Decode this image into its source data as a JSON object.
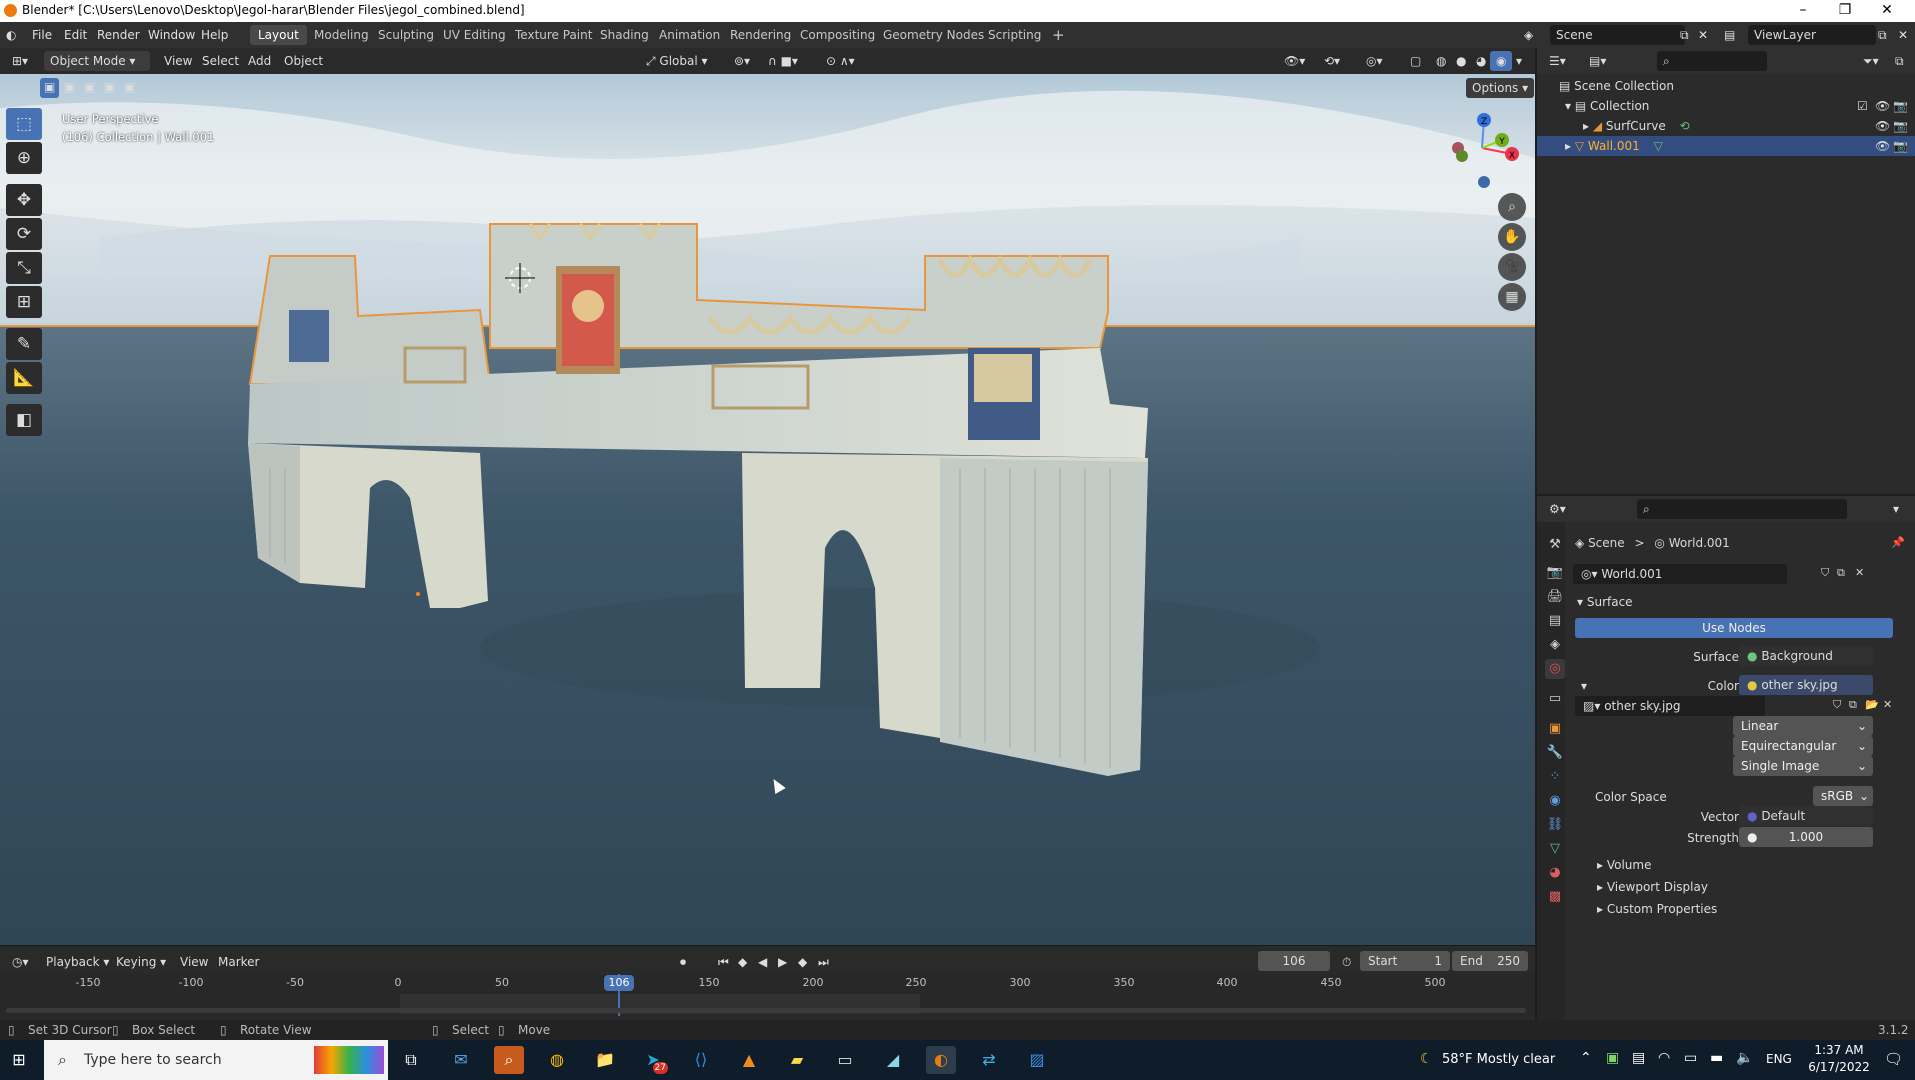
{
  "window": {
    "title": "Blender* [C:\\Users\\Lenovo\\Desktop\\Jegol-harar\\Blender Files\\jegol_combined.blend]"
  },
  "menus": [
    "File",
    "Edit",
    "Render",
    "Window",
    "Help"
  ],
  "workspaces": [
    "Layout",
    "Modeling",
    "Sculpting",
    "UV Editing",
    "Texture Paint",
    "Shading",
    "Animation",
    "Rendering",
    "Compositing",
    "Geometry Nodes",
    "Scripting"
  ],
  "add_workspace": "+",
  "scene": {
    "label": "Scene",
    "viewlayer": "ViewLayer"
  },
  "viewport": {
    "mode": "Object Mode",
    "menus": [
      "View",
      "Select",
      "Add",
      "Object"
    ],
    "transform": "Global",
    "options": "Options",
    "overlay_line1": "User Perspective",
    "overlay_line2": "(106) Collection | Wall.001",
    "gizmo": {
      "z": "Z",
      "y": "Y",
      "x": "X"
    }
  },
  "outliner": {
    "root": "Scene Collection",
    "items": [
      {
        "label": "Collection"
      },
      {
        "label": "SurfCurve"
      },
      {
        "label": "Wall.001"
      }
    ]
  },
  "properties": {
    "breadcrumb_scene": "Scene",
    "breadcrumb_sep": ">",
    "breadcrumb_world": "World.001",
    "world_name": "World.001",
    "surface_panel": "Surface",
    "use_nodes": "Use Nodes",
    "surface_label": "Surface",
    "surface_value": "Background",
    "color_label": "Color",
    "color_value": "other sky.jpg",
    "image_name": "other sky.jpg",
    "interpolation": "Linear",
    "projection": "Equirectangular",
    "source": "Single Image",
    "colorspace_label": "Color Space",
    "colorspace_value": "sRGB",
    "vector_label": "Vector",
    "vector_value": "Default",
    "strength_label": "Strength",
    "strength_value": "1.000",
    "panels": [
      "Volume",
      "Viewport Display",
      "Custom Properties"
    ]
  },
  "timeline": {
    "menus": [
      "Playback",
      "Keying",
      "View",
      "Marker"
    ],
    "current_frame": "106",
    "start_label": "Start",
    "start_value": "1",
    "end_label": "End",
    "end_value": "250",
    "ticks": [
      "-150",
      "-100",
      "-50",
      "0",
      "50",
      "150",
      "200",
      "250",
      "300",
      "350",
      "400",
      "450",
      "500"
    ],
    "cursor_label": "106"
  },
  "statusbar": {
    "items": [
      "Set 3D Cursor",
      "Box Select",
      "Rotate View",
      "Select",
      "Move"
    ],
    "version": "3.1.2"
  },
  "taskbar": {
    "search_placeholder": "Type here to search",
    "weather": "58°F  Mostly clear",
    "language": "ENG",
    "time": "1:37 AM",
    "date": "6/17/2022",
    "badge": "27"
  }
}
